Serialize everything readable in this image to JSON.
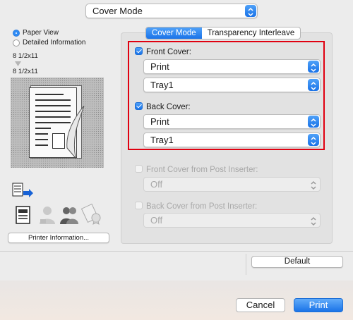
{
  "top_popup": {
    "value": "Cover Mode"
  },
  "view_options": {
    "paper_view": "Paper View",
    "detailed_information": "Detailed Information"
  },
  "paper_sizes": {
    "top": "8 1/2x11",
    "bottom": "8 1/2x11"
  },
  "printer_info_button": "Printer Information...",
  "tabs": [
    "Cover Mode",
    "Transparency Interleave"
  ],
  "front_cover": {
    "label": "Front Cover:",
    "print": "Print",
    "tray": "Tray1",
    "checked": true
  },
  "back_cover": {
    "label": "Back Cover:",
    "print": "Print",
    "tray": "Tray1",
    "checked": true
  },
  "front_post_inserter": {
    "label": "Front Cover from Post Inserter:",
    "value": "Off",
    "checked": false
  },
  "back_post_inserter": {
    "label": "Back Cover from Post Inserter:",
    "value": "Off",
    "checked": false
  },
  "default_button": "Default",
  "cancel_button": "Cancel",
  "print_button": "Print",
  "colors": {
    "accent": "#1a73e8",
    "highlight_border": "#e00010",
    "panel": "#e2e2e2"
  },
  "icons": [
    "chevron-updown-icon",
    "paper-view-icon",
    "document-icon",
    "users-icon",
    "certificate-icon"
  ]
}
